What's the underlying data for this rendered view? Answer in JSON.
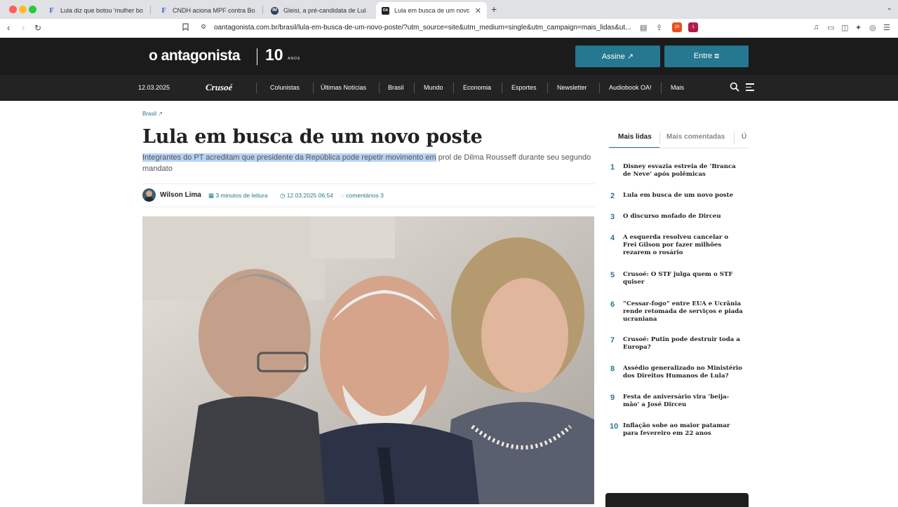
{
  "browser": {
    "tabs": [
      {
        "icon": "F",
        "title": "Lula diz que botou 'mulher bonita"
      },
      {
        "icon": "F",
        "title": "CNDH aciona MPF contra Bolson"
      },
      {
        "icon": "IM",
        "title": "Gleisi, a pré-candidata de Lula à"
      },
      {
        "icon": "OA",
        "title": "Lula em busca de um novo p"
      }
    ],
    "new_tab": "+",
    "url": "oantagonista.com.br/brasil/lula-em-busca-de-um-novo-poste/?utm_source=site&utm_medium=single&utm_campaign=mais_lidas&ut...",
    "ext_badge_1": "20",
    "ext_badge_2": "1"
  },
  "site": {
    "logo": "o antagonista",
    "logo_ten": "10",
    "logo_anos": "ANOS",
    "assine": "Assine ↗",
    "entre": "Entre ⧈",
    "date": "12.03.2025",
    "crusoe": "Crusoé",
    "nav": [
      "Colunistas",
      "Últimas Notícias",
      "Brasil",
      "Mundo",
      "Economia",
      "Esportes",
      "Newsletter",
      "Audiobook OA!",
      "Mais"
    ]
  },
  "article": {
    "breadcrumb": "Brasil ↗",
    "headline": "Lula em busca de um novo poste",
    "subtitle_selected": "Integrantes do PT acreditam que presidente da República pode repetir movimento em",
    "subtitle_rest": " prol de Dilma Rousseff durante seu segundo mandato",
    "author": "Wilson Lima",
    "read_time": "3 minutos de leitura",
    "published": "12.03.2025 06:54",
    "comments": "comentários 3"
  },
  "sidebar": {
    "tabs": [
      "Mais lidas",
      "Mais comentadas",
      "Ú"
    ],
    "items": [
      {
        "n": "1",
        "text": "Disney esvazia estreia de ‘Branca de Neve’ após polêmicas"
      },
      {
        "n": "2",
        "text": "Lula em busca de um novo poste"
      },
      {
        "n": "3",
        "text": "O discurso mofado de Dirceu"
      },
      {
        "n": "4",
        "text": "A esquerda resolveu cancelar o Frei Gilson por fazer milhões rezarem o rosário"
      },
      {
        "n": "5",
        "text": "Crusoé: O STF julga quem o STF quiser"
      },
      {
        "n": "6",
        "text": "“Cessar-fogo” entre EUA e Ucrânia rende retomada de serviços e piada ucraniana"
      },
      {
        "n": "7",
        "text": "Crusoé: Putin pode destruir toda a Europa?"
      },
      {
        "n": "8",
        "text": "Assédio generalizado no Ministério dos Direitos Humanos de Lula?"
      },
      {
        "n": "9",
        "text": "Festa de aniversário vira ‘beija-mão’ a José Dirceu"
      },
      {
        "n": "10",
        "text": "Inflação sobe ao maior patamar para fevereiro em 22 anos"
      }
    ]
  },
  "colors": {
    "accent": "#24788f",
    "header_bg": "#1b1b1b",
    "nav_bg": "#232323",
    "selection": "#b7d3f5"
  }
}
